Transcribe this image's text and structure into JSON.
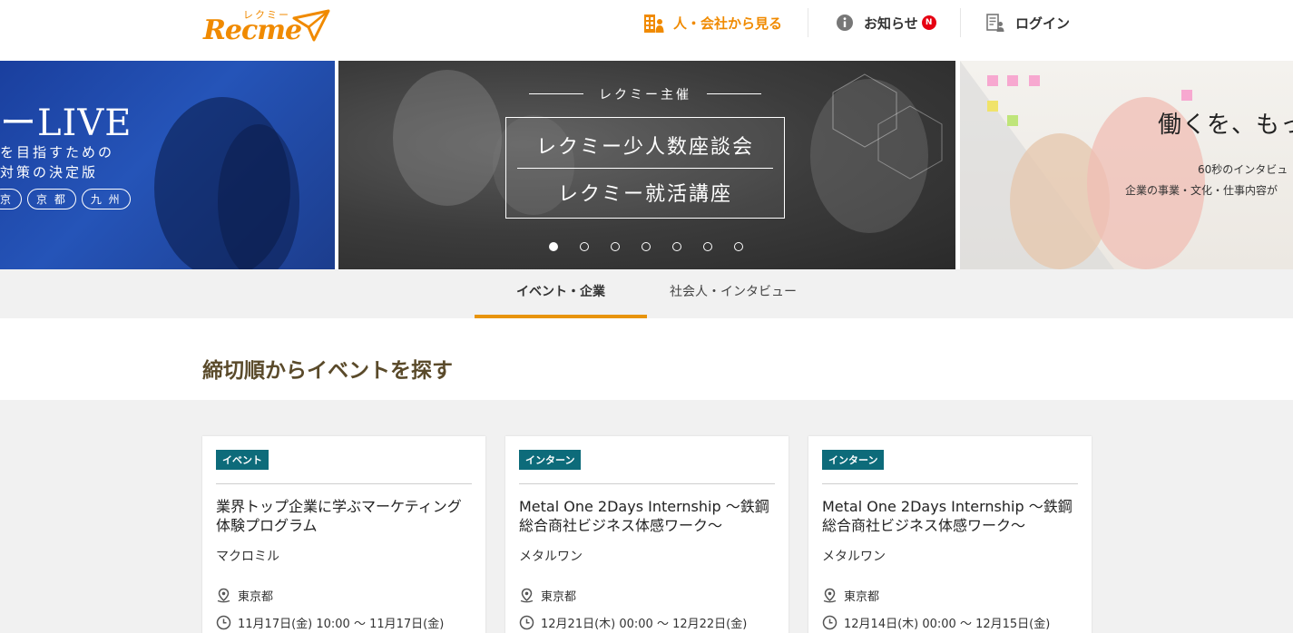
{
  "header": {
    "logo_kana": "レクミー",
    "logo_text": "Recme",
    "nav": {
      "people_label": "人・会社から見る",
      "news_label": "お知らせ",
      "news_badge": "N",
      "login_label": "ログイン"
    }
  },
  "carousel": {
    "left": {
      "title": "ーLIVE",
      "line1": "を目指すための",
      "line2": "対策の決定版",
      "pills": [
        "京",
        "京 都",
        "九 州"
      ]
    },
    "center": {
      "kicker": "レクミー主催",
      "line1": "レクミー少人数座談会",
      "line2": "レクミー就活講座"
    },
    "right": {
      "title": "働くを、もっ",
      "sub1": "60秒のインタビュ",
      "sub2": "企業の事業・文化・仕事内容が"
    },
    "dot_count": 7,
    "active_dot": 0
  },
  "tabs": [
    {
      "label": "イベント・企業",
      "active": true
    },
    {
      "label": "社会人・インタビュー",
      "active": false
    }
  ],
  "section": {
    "title": "締切順からイベントを探す"
  },
  "cards": [
    {
      "tag": "イベント",
      "title": "業界トップ企業に学ぶマーケティング体験プログラム",
      "company": "マクロミル",
      "location": "東京都",
      "date": "11月17日(金) 10:00 〜 11月17日(金)"
    },
    {
      "tag": "インターン",
      "title": "Metal One 2Days Internship 〜鉄鋼総合商社ビジネス体感ワーク〜",
      "company": "メタルワン",
      "location": "東京都",
      "date": "12月21日(木) 00:00 〜 12月22日(金)"
    },
    {
      "tag": "インターン",
      "title": "Metal One 2Days Internship 〜鉄鋼総合商社ビジネス体感ワーク〜",
      "company": "メタルワン",
      "location": "東京都",
      "date": "12月14日(木) 00:00 〜 12月15日(金)"
    }
  ],
  "colors": {
    "brand_orange": "#f08a00",
    "tab_underline": "#e8940b",
    "tag_teal": "#0d6b7a",
    "badge_red": "#e60012"
  }
}
